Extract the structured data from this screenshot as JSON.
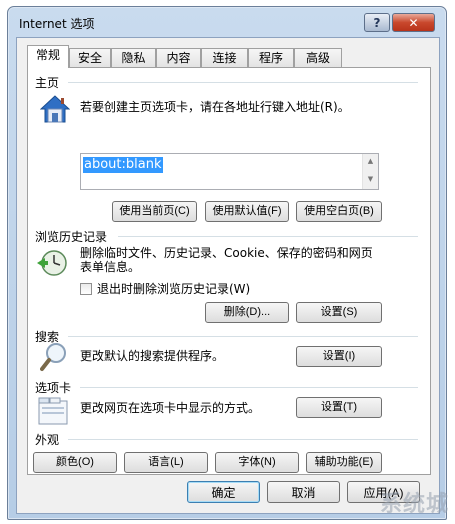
{
  "window": {
    "title": "Internet 选项",
    "help_label": "?",
    "close_label": "✕"
  },
  "tabs": [
    {
      "label": "常规",
      "active": true
    },
    {
      "label": "安全"
    },
    {
      "label": "隐私"
    },
    {
      "label": "内容"
    },
    {
      "label": "连接"
    },
    {
      "label": "程序"
    },
    {
      "label": "高级"
    }
  ],
  "home": {
    "title": "主页",
    "description": "若要创建主页选项卡，请在各地址行键入地址(R)。",
    "value": "about:blank",
    "buttons": {
      "current": "使用当前页(C)",
      "default": "使用默认值(F)",
      "blank": "使用空白页(B)"
    },
    "icon": "house-icon"
  },
  "history": {
    "title": "浏览历史记录",
    "description_line1": "删除临时文件、历史记录、Cookie、保存的密码和网页",
    "description_line2": "表单信息。",
    "checkbox_label": "退出时删除浏览历史记录(W)",
    "checkbox_checked": false,
    "buttons": {
      "delete": "删除(D)...",
      "settings": "设置(S)"
    },
    "icon": "history-clock-icon"
  },
  "search": {
    "title": "搜索",
    "description": "更改默认的搜索提供程序。",
    "button": "设置(I)",
    "icon": "magnifier-icon"
  },
  "tabs_section": {
    "title": "选项卡",
    "description": "更改网页在选项卡中显示的方式。",
    "button": "设置(T)",
    "icon": "tabbed-window-icon"
  },
  "appearance": {
    "title": "外观",
    "buttons": {
      "colors": "颜色(O)",
      "languages": "语言(L)",
      "fonts": "字体(N)",
      "accessibility": "辅助功能(E)"
    }
  },
  "footer": {
    "ok": "确定",
    "cancel": "取消",
    "apply": "应用(A)"
  },
  "watermark": "系统城"
}
